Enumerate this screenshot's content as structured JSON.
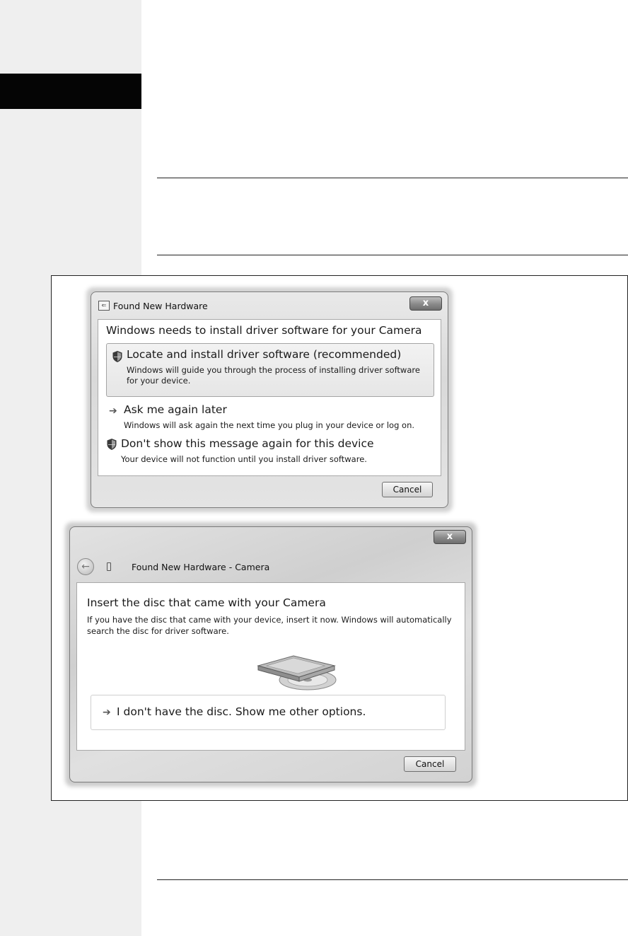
{
  "dialog1": {
    "title": "Found New Hardware",
    "close_label": "x",
    "heading": "Windows needs to install driver software for your Camera",
    "options": [
      {
        "title": "Locate and install driver software (recommended)",
        "description": "Windows will guide you through the process of installing driver software for your device.",
        "icon": "shield-icon"
      },
      {
        "title": "Ask me again later",
        "description": "Windows will ask again the next time you plug in your device or log on.",
        "icon": "arrow-icon"
      },
      {
        "title": "Don't show this message again for this device",
        "description": "Your device will not function until you install driver software.",
        "icon": "shield-icon"
      }
    ],
    "cancel_label": "Cancel"
  },
  "dialog2": {
    "title": "Found New Hardware - Camera",
    "close_label": "x",
    "heading": "Insert the disc that came with your Camera",
    "description": "If you have the disc that came with your device, insert it now.  Windows will automatically search the disc for driver software.",
    "no_disc_label": "I don't have the disc.  Show me other options.",
    "cancel_label": "Cancel"
  },
  "icons": {
    "back": "back-arrow-icon",
    "device": "device-icon",
    "disc": "disc-drive-icon",
    "arrow": "arrow-icon",
    "shield": "shield-icon"
  },
  "colors": {
    "margin_column": "#efefef",
    "margin_tab": "#050505",
    "rule": "#222222"
  }
}
